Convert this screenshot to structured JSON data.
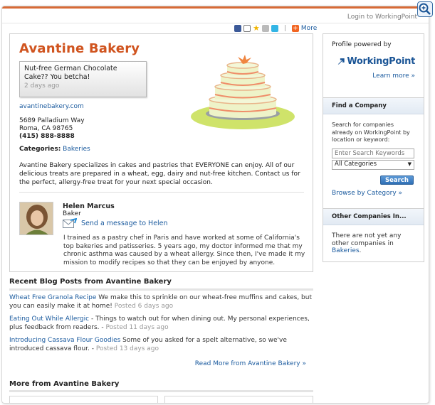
{
  "header": {
    "login_text": "Login to WorkingPoint"
  },
  "sharebar": {
    "icons": [
      "facebook-icon",
      "email-icon",
      "star-icon",
      "print-icon",
      "twitter-icon",
      "plus-icon"
    ],
    "more_label": "More"
  },
  "business": {
    "name": "Avantine Bakery",
    "status_text": "Nut-free German Chocolate Cake?? You betcha!",
    "status_time": "2 days ago",
    "website": "avantinebakery.com",
    "address_line1": "5689 Palladium Way",
    "address_line2": "Roma, CA 98765",
    "phone": "(415) 888-8888",
    "categories_label": "Categories:",
    "category": "Bakeries",
    "description": "Avantine Bakery specializes in cakes and pastries that EVERYONE can enjoy. All of our delicious treats are prepared in a wheat, egg, dairy and nut-free kitchen. Contact us for the perfect, allergy-free treat for your next special occasion."
  },
  "owner": {
    "name": "Helen Marcus",
    "role": "Baker",
    "message_link": "Send a message to Helen",
    "bio": "I trained as a pastry chef in Paris and have worked at some of California's top bakeries and patisseries. 5 years ago, my doctor informed me that my chronic asthma was caused by a wheat allergy. Since then, I've made it my mission to modify recipes so that they can be enjoyed by anyone."
  },
  "blog": {
    "heading": "Recent Blog Posts from Avantine Bakery",
    "posts": [
      {
        "title": "Wheat Free Granola Recipe",
        "excerpt": " We make this to sprinkle on our wheat-free muffins and cakes, but you can easily make it at home!",
        "posted": "Posted 6 days ago"
      },
      {
        "title": "Eating Out While Allergic",
        "excerpt": " - Things to watch out for when dining out. My personal experiences, plus feedback from readers.",
        "posted": "Posted 11 days ago"
      },
      {
        "title": "Introducing Cassava Flour Goodies",
        "excerpt": " Some of you asked for a spelt alternative, so we've introduced cassava flour.",
        "posted": "Posted 13 days ago"
      }
    ],
    "read_more": "Read More from Avantine Bakery »"
  },
  "more": {
    "heading": "More from Avantine Bakery"
  },
  "sidebar": {
    "powered_label": "Profile powered by",
    "brand": "WorkingPoint",
    "learn_more": "Learn more »",
    "find_heading": "Find a Company",
    "find_text": "Search for companies already on WorkingPoint by location or keyword:",
    "search_placeholder": "Enter Search Keywords",
    "category_selected": "All Categories",
    "search_button": "Search",
    "browse_link": "Browse by Category »",
    "other_heading": "Other Companies In...",
    "other_text": "There are not yet any other companies in",
    "other_link": "Bakeries",
    "other_suffix": "."
  },
  "colors": {
    "accent": "#d0541f",
    "link": "#1a5a9e",
    "brand_blue": "#1b5596"
  }
}
